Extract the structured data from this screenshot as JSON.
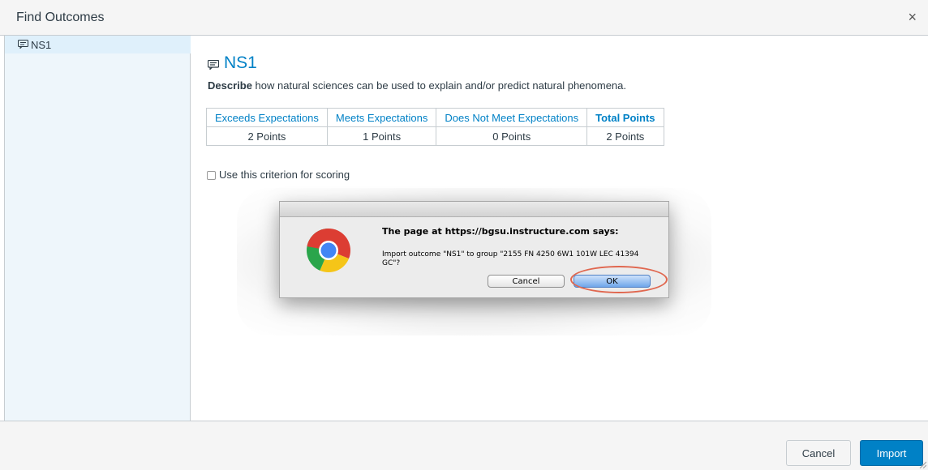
{
  "modal": {
    "title": "Find Outcomes",
    "close_glyph": "×"
  },
  "sidebar": {
    "items": [
      {
        "label": "NS1",
        "icon": "outcome-icon"
      }
    ]
  },
  "outcome": {
    "title": "NS1",
    "description_bold": "Describe",
    "description_rest": " how natural sciences can be used to explain and/or predict natural phenomena.",
    "rubric": {
      "headers": [
        "Exceeds Expectations",
        "Meets Expectations",
        "Does Not Meet Expectations",
        "Total Points"
      ],
      "values": [
        "2 Points",
        "1 Points",
        "0 Points",
        "2 Points"
      ]
    },
    "criterion_label": "Use this criterion for scoring",
    "criterion_checked": false
  },
  "footer": {
    "cancel_label": "Cancel",
    "import_label": "Import"
  },
  "alert": {
    "heading": "The page at https://bgsu.instructure.com says:",
    "message": "Import outcome \"NS1\" to group \"2155 FN 4250 6W1 101W LEC 41394 GC\"?",
    "cancel_label": "Cancel",
    "ok_label": "OK"
  },
  "colors": {
    "accent": "#0081c6",
    "sidebar_bg": "#eef6fb",
    "highlight_ring": "#e0674f"
  }
}
